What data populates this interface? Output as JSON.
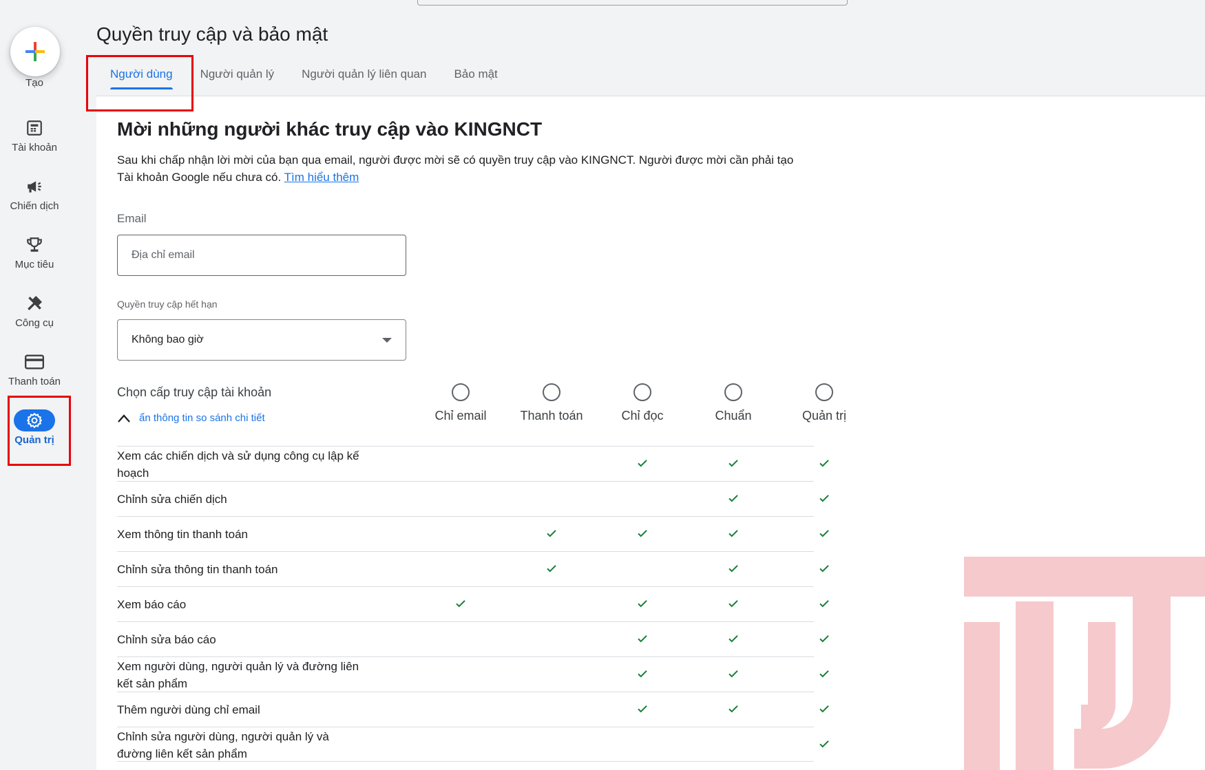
{
  "header": {
    "title": "Quyền truy cập và bảo mật",
    "tabs": [
      {
        "label": "Người dùng",
        "active": true
      },
      {
        "label": "Người quản lý",
        "active": false
      },
      {
        "label": "Người quản lý liên quan",
        "active": false
      },
      {
        "label": "Bảo mật",
        "active": false
      }
    ]
  },
  "sidebar": {
    "create_label": "Tạo",
    "items": [
      {
        "label": "Tài khoản",
        "icon": "account-icon"
      },
      {
        "label": "Chiến dịch",
        "icon": "megaphone-icon"
      },
      {
        "label": "Mục tiêu",
        "icon": "trophy-icon"
      },
      {
        "label": "Công cụ",
        "icon": "tools-icon"
      },
      {
        "label": "Thanh toán",
        "icon": "credit-card-icon"
      },
      {
        "label": "Quản trị",
        "icon": "gear-icon",
        "active": true
      }
    ]
  },
  "invite": {
    "title": "Mời những người khác truy cập vào KINGNCT",
    "description": "Sau khi chấp nhận lời mời của bạn qua email, người được mời sẽ có quyền truy cập vào KINGNCT. Người được mời cần phải tạo Tài khoản Google nếu chưa có.",
    "learn_more": "Tìm hiểu thêm",
    "email_label": "Email",
    "email_placeholder": "Địa chỉ email",
    "email_value": "",
    "expire_label": "Quyền truy cập hết hạn",
    "expire_value": "Không bao giờ",
    "level_label": "Chọn cấp truy cập tài khoản",
    "toggle_details": "ẩn thông tin so sánh chi tiết"
  },
  "access_levels": [
    "Chỉ email",
    "Thanh toán",
    "Chỉ đọc",
    "Chuẩn",
    "Quản trị"
  ],
  "permissions": [
    {
      "name": "Xem các chiến dịch và sử dụng công cụ lập kế hoạch",
      "checks": [
        false,
        false,
        true,
        true,
        true
      ]
    },
    {
      "name": "Chỉnh sửa chiến dịch",
      "checks": [
        false,
        false,
        false,
        true,
        true
      ]
    },
    {
      "name": "Xem thông tin thanh toán",
      "checks": [
        false,
        true,
        true,
        true,
        true
      ]
    },
    {
      "name": "Chỉnh sửa thông tin thanh toán",
      "checks": [
        false,
        true,
        false,
        true,
        true
      ]
    },
    {
      "name": "Xem báo cáo",
      "checks": [
        true,
        false,
        true,
        true,
        true
      ]
    },
    {
      "name": "Chỉnh sửa báo cáo",
      "checks": [
        false,
        false,
        true,
        true,
        true
      ]
    },
    {
      "name": "Xem người dùng, người quản lý và đường liên kết sản phẩm",
      "checks": [
        false,
        false,
        true,
        true,
        true
      ]
    },
    {
      "name": "Thêm người dùng chỉ email",
      "checks": [
        false,
        false,
        true,
        true,
        true
      ]
    },
    {
      "name": "Chỉnh sửa người dùng, người quản lý và đường liên kết sản phẩm",
      "checks": [
        false,
        false,
        false,
        false,
        true
      ]
    }
  ],
  "colors": {
    "accent": "#1a73e8",
    "check": "#188038",
    "highlight_box": "#e8000b",
    "watermark": "#f6c9cc"
  }
}
